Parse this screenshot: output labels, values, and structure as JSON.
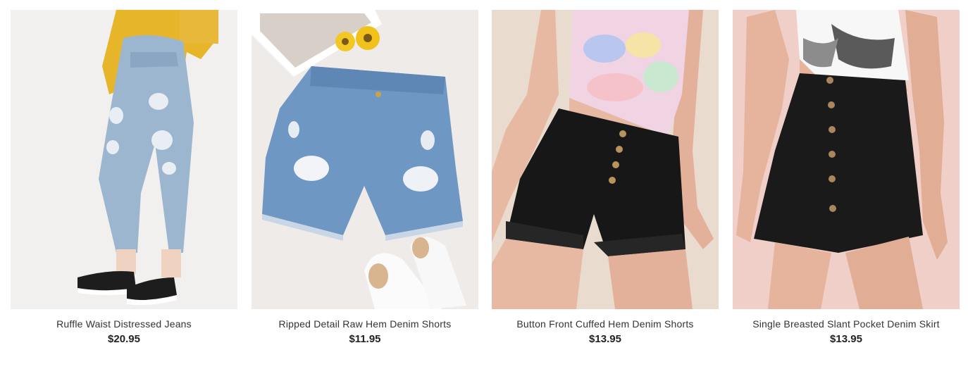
{
  "products": [
    {
      "image_alt": "Ruffle Waist Distressed Jeans",
      "title": "Ruffle Waist Distressed Jeans",
      "price": "$20.95"
    },
    {
      "image_alt": "Ripped Detail Raw Hem Denim Shorts",
      "title": "Ripped Detail Raw Hem Denim Shorts",
      "price": "$11.95"
    },
    {
      "image_alt": "Button Front Cuffed Hem Denim Shorts",
      "title": "Button Front Cuffed Hem Denim Shorts",
      "price": "$13.95"
    },
    {
      "image_alt": "Single Breasted Slant Pocket Denim Skirt",
      "title": "Single Breasted Slant Pocket Denim Skirt",
      "price": "$13.95"
    }
  ]
}
